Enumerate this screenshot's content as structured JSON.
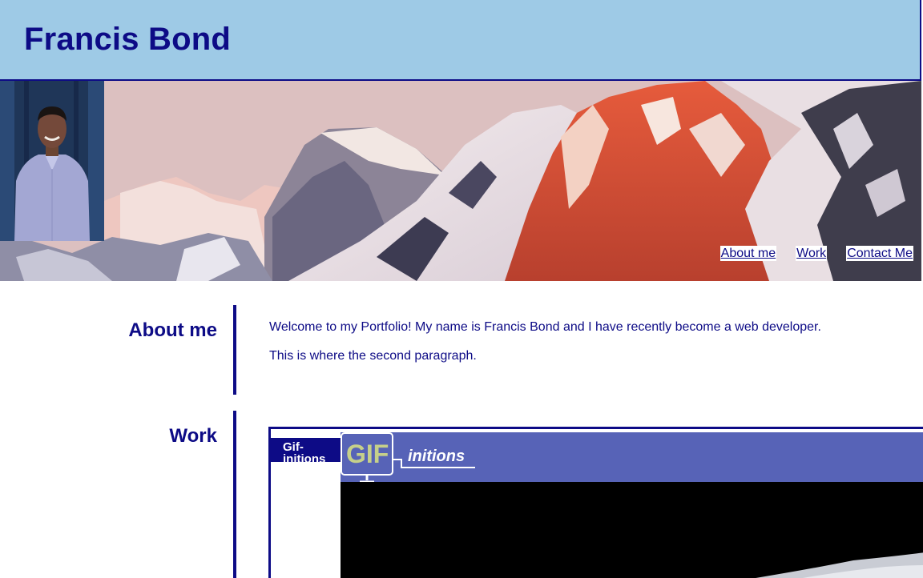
{
  "header": {
    "title": "Francis Bond"
  },
  "nav": {
    "items": [
      {
        "label": "About me"
      },
      {
        "label": "Work"
      },
      {
        "label": "Contact Me"
      }
    ]
  },
  "about": {
    "heading": "About me",
    "paragraphs": [
      "Welcome to my Portfolio! My name is Francis Bond and I have recently become a web developer.",
      "This is where the second paragraph."
    ]
  },
  "work": {
    "heading": "Work",
    "projects": [
      {
        "title": "Gif-initions"
      }
    ]
  },
  "colors": {
    "brand_navy": "#0d0b86",
    "header_bg": "#9ecae6",
    "project_banner": "#5763b7"
  }
}
